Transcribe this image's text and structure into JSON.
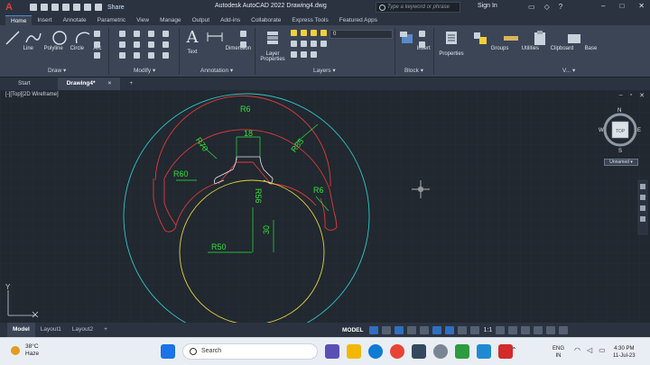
{
  "app": {
    "title": "Autodesk AutoCAD 2022   Drawing4.dwg",
    "logo": "A",
    "share_label": "Share",
    "search_placeholder": "Type a keyword or phrase",
    "sign_in": "Sign In"
  },
  "ribbon_tabs": [
    "Home",
    "Insert",
    "Annotate",
    "Parametric",
    "View",
    "Manage",
    "Output",
    "Add-ins",
    "Collaborate",
    "Express Tools",
    "Featured Apps"
  ],
  "ribbon": {
    "line": "Line",
    "polyline": "Polyline",
    "circle": "Circle",
    "arc": "Arc",
    "text": "Text",
    "dimension": "Dimension",
    "layer_properties": "Layer Properties",
    "layer_current": "0",
    "insert": "Insert",
    "properties": "Properties",
    "groups": "Groups",
    "utilities": "Utilities",
    "clipboard": "Clipboard",
    "base": "Base",
    "panels": {
      "draw": "Draw ▾",
      "modify": "Modify ▾",
      "annotation": "Annotation ▾",
      "layers": "Layers ▾",
      "block": "Block ▾",
      "view": "V... ▾"
    }
  },
  "doc_tabs": {
    "start": "Start",
    "drawing": "Drawing4*",
    "close": "×",
    "add": "+"
  },
  "viewport": {
    "label": "[-][Top][2D Wireframe]",
    "viewcube": {
      "top": "TOP",
      "n": "N",
      "s": "S",
      "e": "E",
      "w": "W"
    },
    "ucs_name": "Unnamed ▾",
    "ucs_y": "Y"
  },
  "drawing": {
    "dims": {
      "r6_top": "R6",
      "r70": "R70",
      "d18": "18",
      "r85": "R85",
      "r60": "R60",
      "r56": "R56",
      "r6_right": "R6",
      "d30": "30",
      "r50": "R50"
    },
    "colors": {
      "outer": "#2fc6c6",
      "slot": "#e03a3a",
      "inner": "#e0d23a",
      "dim": "#2fe03a",
      "cursor": "#e6e6e6"
    }
  },
  "layout_tabs": [
    "Model",
    "Layout1",
    "Layout2",
    "+"
  ],
  "status": {
    "model": "MODEL",
    "scale": "1:1"
  },
  "taskbar": {
    "temp": "38°C",
    "condition": "Haze",
    "search": "Search",
    "lang1": "ENG",
    "lang2": "IN",
    "time": "4:30 PM",
    "date": "11-Jul-23"
  }
}
